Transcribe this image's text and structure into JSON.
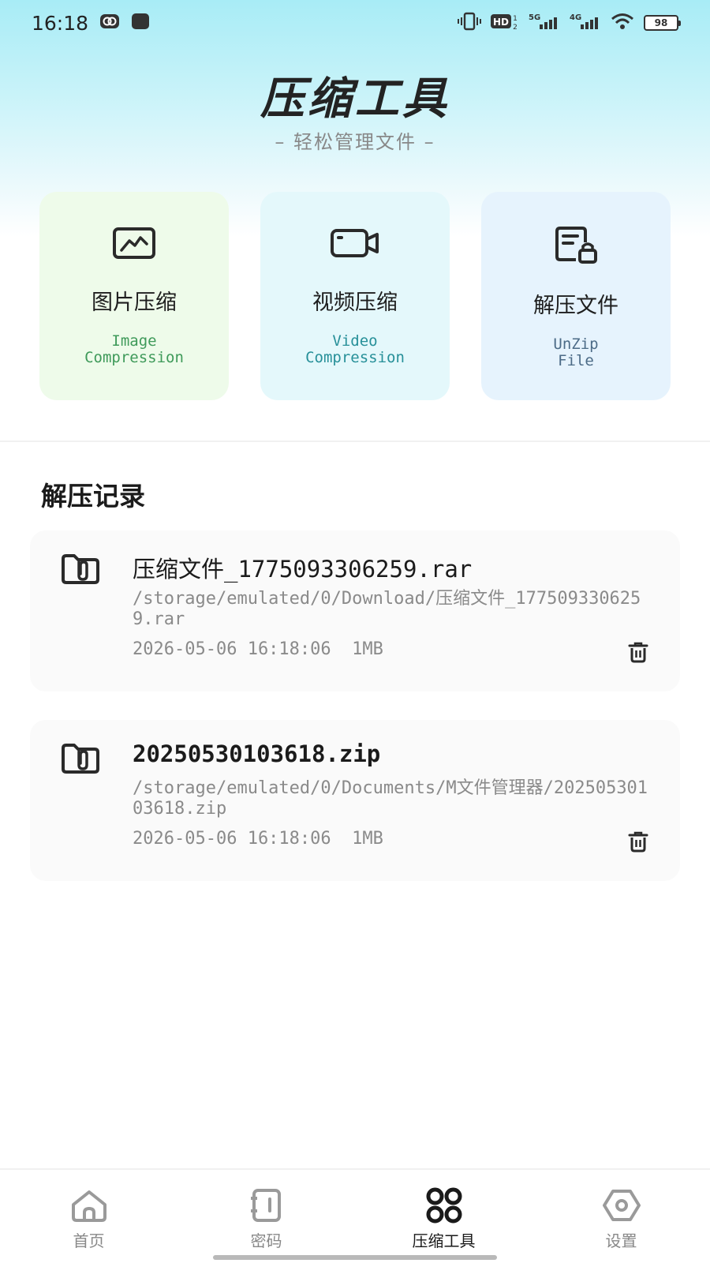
{
  "status_bar": {
    "time": "16:18",
    "network_hd": "HD",
    "network_5g": "5G",
    "network_4g": "4G",
    "battery": "98"
  },
  "header": {
    "title": "压缩工具",
    "subtitle": "– 轻松管理文件 –"
  },
  "tools": [
    {
      "label": "图片压缩",
      "sub": "Image\nCompression",
      "icon": "image-icon"
    },
    {
      "label": "视频压缩",
      "sub": "Video\nCompression",
      "icon": "video-icon"
    },
    {
      "label": "解压文件",
      "sub": "UnZip\nFile",
      "icon": "unzip-file-icon"
    }
  ],
  "records_section": {
    "title": "解压记录",
    "items": [
      {
        "name": "压缩文件_1775093306259.rar",
        "path": "/storage/emulated/0/Download/压缩文件_1775093306259.rar",
        "date": "2026-05-06 16:18:06",
        "size": "1MB"
      },
      {
        "name": "20250530103618.zip",
        "path": "/storage/emulated/0/Documents/M文件管理器/20250530103618.zip",
        "date": "2026-05-06 16:18:06",
        "size": "1MB"
      }
    ]
  },
  "bottom_nav": {
    "items": [
      {
        "label": "首页",
        "icon": "home-icon"
      },
      {
        "label": "密码",
        "icon": "password-icon"
      },
      {
        "label": "压缩工具",
        "icon": "grid-icon",
        "active": true
      },
      {
        "label": "设置",
        "icon": "settings-icon"
      }
    ]
  },
  "colors": {
    "accent_green": "#3f9a5a",
    "accent_cyan": "#279099",
    "hero_top": "#a8ecf6"
  }
}
